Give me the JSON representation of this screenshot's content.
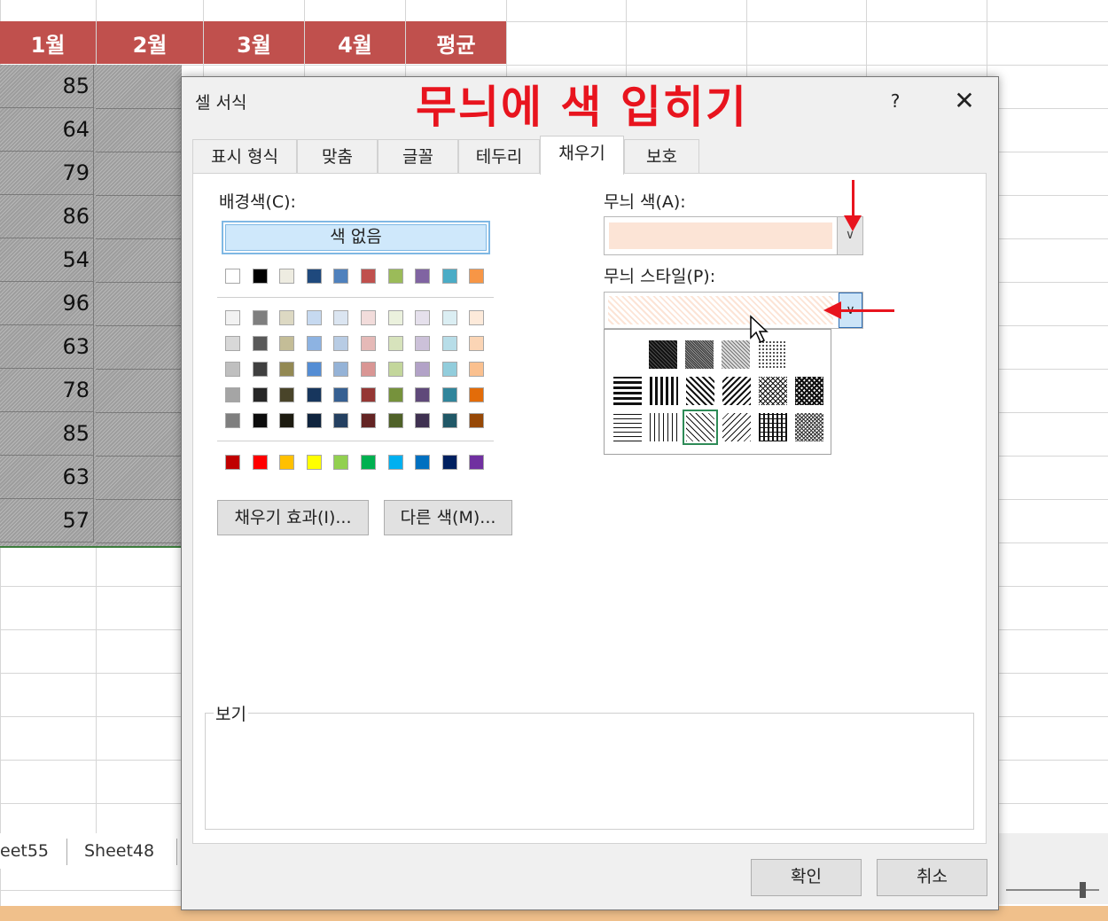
{
  "sheet": {
    "headers": [
      "1월",
      "2월",
      "3월",
      "4월",
      "평균"
    ],
    "col1_values": [
      "85",
      "64",
      "79",
      "86",
      "54",
      "96",
      "63",
      "78",
      "85",
      "63",
      "57"
    ],
    "tabs": [
      "eet55",
      "Sheet48"
    ]
  },
  "dialog": {
    "title": "셀 서식",
    "annotation": "무늬에 색 입히기",
    "help": "?",
    "close": "✕",
    "tabs": [
      "표시 형식",
      "맞춤",
      "글꼴",
      "테두리",
      "채우기",
      "보호"
    ],
    "active_tab": "채우기",
    "background_color_label": "배경색(C):",
    "no_color_button": "색 없음",
    "fill_effects_button": "채우기 효과(I)...",
    "more_colors_button": "다른 색(M)...",
    "pattern_color_label": "무늬 색(A):",
    "pattern_color_value": "#fce4d6",
    "pattern_style_label": "무늬 스타일(P):",
    "preview_label": "보기",
    "ok_button": "확인",
    "cancel_button": "취소"
  },
  "palette": {
    "row1": [
      "#ffffff",
      "#000000",
      "#eeece1",
      "#1f497d",
      "#4f81bd",
      "#c0504d",
      "#9bbb59",
      "#8064a2",
      "#4bacc6",
      "#f79646"
    ],
    "tints": [
      [
        "#f2f2f2",
        "#7f7f7f",
        "#ddd9c3",
        "#c6d9f0",
        "#dbe5f1",
        "#f2dcdb",
        "#ebf1dd",
        "#e5e0ec",
        "#dbeef3",
        "#fdeada"
      ],
      [
        "#d8d8d8",
        "#595959",
        "#c4bd97",
        "#8db3e2",
        "#b8cce4",
        "#e5b9b7",
        "#d7e3bc",
        "#ccc1d9",
        "#b7dde8",
        "#fbd5b5"
      ],
      [
        "#bfbfbf",
        "#3f3f3f",
        "#938953",
        "#548dd4",
        "#95b3d7",
        "#d99694",
        "#c3d69b",
        "#b2a2c7",
        "#92cddc",
        "#fac08f"
      ],
      [
        "#a5a5a5",
        "#262626",
        "#494429",
        "#17365d",
        "#366092",
        "#953734",
        "#76923c",
        "#5f497a",
        "#31859b",
        "#e36c09"
      ],
      [
        "#7f7f7f",
        "#0c0c0c",
        "#1d1b10",
        "#0f243e",
        "#244061",
        "#632423",
        "#4f6128",
        "#3f3151",
        "#205867",
        "#974806"
      ]
    ],
    "standard": [
      "#c00000",
      "#ff0000",
      "#ffc000",
      "#ffff00",
      "#92d050",
      "#00b050",
      "#00b0f0",
      "#0070c0",
      "#002060",
      "#7030a0"
    ]
  },
  "patterns": {
    "row1": [
      "none",
      "solid75",
      "solid50",
      "solid25",
      "dots12"
    ],
    "row2": [
      "hstripe-thick",
      "vstripe-thick",
      "rdiag-thick",
      "ldiag-thick",
      "diag-cross",
      "thick-diag-cross"
    ],
    "row3": [
      "hstripe-thin",
      "vstripe-thin",
      "rdiag-thin",
      "ldiag-thin",
      "grid-thin",
      "trellis-thin"
    ],
    "selected": "rdiag-thin"
  },
  "accent_colors": {
    "header_red": "#c0504d",
    "annotation_red": "#e8141e",
    "selection_green": "#2e8b57"
  }
}
